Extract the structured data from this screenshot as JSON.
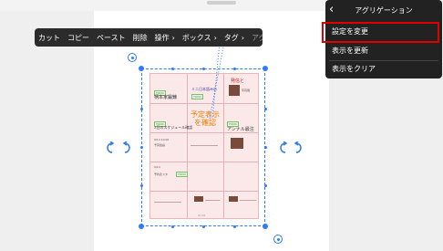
{
  "context_menu": {
    "items": [
      "カット",
      "コピー",
      "ペースト",
      "削除",
      "操作",
      "ボックス",
      "タグ",
      "アグリゲーション"
    ]
  },
  "popover": {
    "title": "アグリゲーション",
    "items": [
      "設定を変更",
      "表示を更新",
      "表示をクリア"
    ],
    "highlighted_index": 0,
    "highlight_color": "#e00000"
  },
  "card": {
    "tags": [
      "TODO",
      "TODO",
      "TODO",
      "TODO",
      "TODO"
    ],
    "notes": [
      "柄本家鍛錬",
      "写真展",
      "ミニ日本語みの",
      "発信と",
      "3日のスケジュール確認",
      "予算会議",
      "アンナル最注",
      "9/14 10:00",
      "9/14",
      "予約表スタ"
    ],
    "center_note": "予定表示を確認",
    "page_number": "01/01"
  },
  "colors": {
    "selection": "#2f7cf5",
    "card_background": "#fbe9ea",
    "menu_background": "#2b2b2b"
  }
}
